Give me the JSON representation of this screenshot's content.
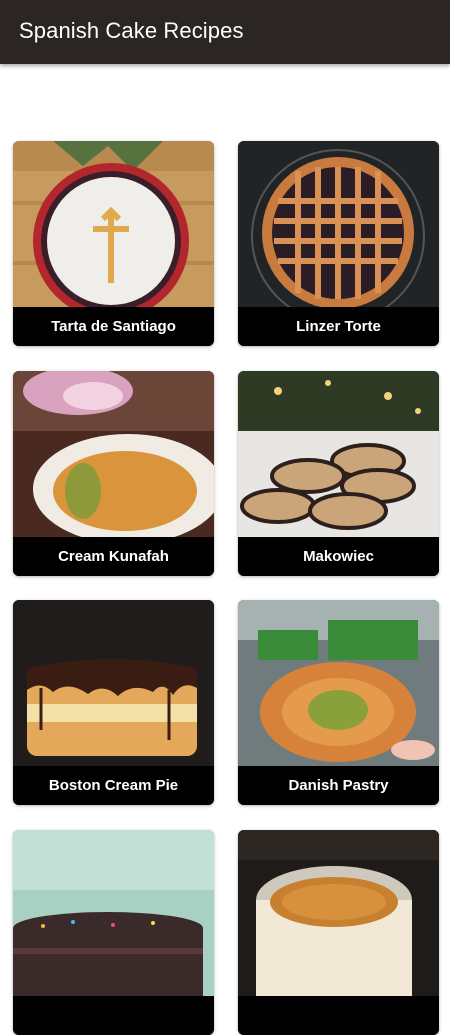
{
  "app": {
    "title": "Spanish Cake Recipes"
  },
  "recipes": [
    {
      "name": "Tarta de Santiago",
      "image": "tarta-de-santiago-photo"
    },
    {
      "name": "Linzer Torte",
      "image": "linzer-torte-photo"
    },
    {
      "name": "Cream Kunafah",
      "image": "cream-kunafah-photo"
    },
    {
      "name": "Makowiec",
      "image": "makowiec-photo"
    },
    {
      "name": "Boston Cream Pie",
      "image": "boston-cream-pie-photo"
    },
    {
      "name": "Danish Pastry",
      "image": "danish-pastry-photo"
    },
    {
      "name": "",
      "image": "chocolate-cake-photo"
    },
    {
      "name": "",
      "image": "custard-pudding-photo"
    }
  ],
  "colors": {
    "appbar": "#2b2624",
    "label_bg": "#000000",
    "label_text": "#ffffff"
  }
}
